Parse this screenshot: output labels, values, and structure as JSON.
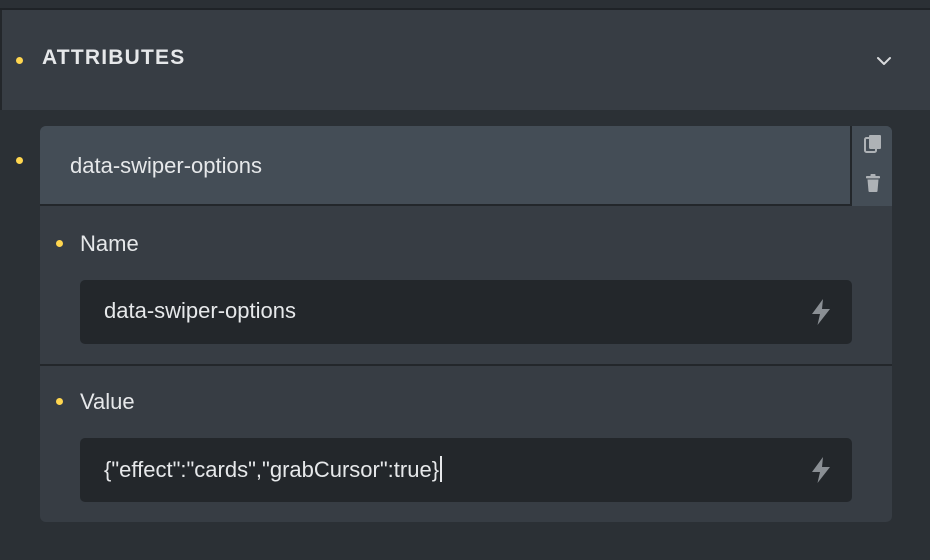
{
  "section": {
    "title": "ATTRIBUTES",
    "toggle_icon": "chevron-down-icon"
  },
  "attribute": {
    "header_label": "data-swiper-options",
    "actions": {
      "duplicate_icon": "copy-icon",
      "delete_icon": "trash-icon"
    },
    "name": {
      "label": "Name",
      "value": "data-swiper-options",
      "dynamic_data_icon": "bolt-icon"
    },
    "value": {
      "label": "Value",
      "value": "{\"effect\":\"cards\",\"grabCursor\":true}",
      "dynamic_data_icon": "bolt-icon"
    }
  },
  "colors": {
    "accent_dot": "#ffd64f",
    "panel_bg": "#373d44",
    "header_bg": "#444d56",
    "input_bg": "#23272b",
    "text": "#e6e8ea"
  }
}
